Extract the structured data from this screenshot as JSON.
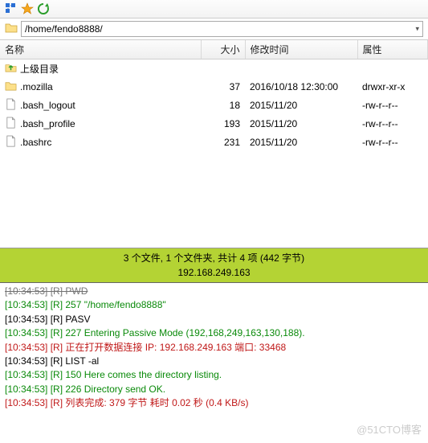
{
  "toolbar": {
    "path": "/home/fendo8888/"
  },
  "columns": {
    "name": "名称",
    "size": "大小",
    "mtime": "修改时间",
    "attrs": "属性"
  },
  "parent_row": {
    "label": "上级目录"
  },
  "files": [
    {
      "type": "folder",
      "name": ".mozilla",
      "size": "37",
      "mtime": "2016/10/18 12:30:00",
      "attrs": "drwxr-xr-x"
    },
    {
      "type": "file",
      "name": ".bash_logout",
      "size": "18",
      "mtime": "2015/11/20",
      "attrs": "-rw-r--r--"
    },
    {
      "type": "file",
      "name": ".bash_profile",
      "size": "193",
      "mtime": "2015/11/20",
      "attrs": "-rw-r--r--"
    },
    {
      "type": "file",
      "name": ".bashrc",
      "size": "231",
      "mtime": "2015/11/20",
      "attrs": "-rw-r--r--"
    }
  ],
  "status": {
    "line1": "3 个文件, 1 个文件夹, 共计 4 项 (442 字节)",
    "line2": "192.168.249.163"
  },
  "log": [
    {
      "t": "[10:34:53]",
      "txt": "[R] PWD",
      "cls": "c-black",
      "cut": true
    },
    {
      "t": "[10:34:53]",
      "txt": "[R] 257 \"/home/fendo8888\"",
      "cls": "c-green"
    },
    {
      "t": "[10:34:53]",
      "txt": "[R] PASV",
      "cls": "c-black"
    },
    {
      "t": "[10:34:53]",
      "txt": "[R] 227 Entering Passive Mode (192,168,249,163,130,188).",
      "cls": "c-green"
    },
    {
      "t": "[10:34:53]",
      "txt": "[R] 正在打开数据连接 IP: 192.168.249.163 端口: 33468",
      "cls": "c-red"
    },
    {
      "t": "[10:34:53]",
      "txt": "[R] LIST -al",
      "cls": "c-black"
    },
    {
      "t": "[10:34:53]",
      "txt": "[R] 150 Here comes the directory listing.",
      "cls": "c-green"
    },
    {
      "t": "[10:34:53]",
      "txt": "[R] 226 Directory send OK.",
      "cls": "c-green"
    },
    {
      "t": "[10:34:53]",
      "txt": "[R] 列表完成: 379 字节 耗时 0.02 秒 (0.4 KB/s)",
      "cls": "c-red"
    }
  ],
  "watermark": "@51CTO博客"
}
